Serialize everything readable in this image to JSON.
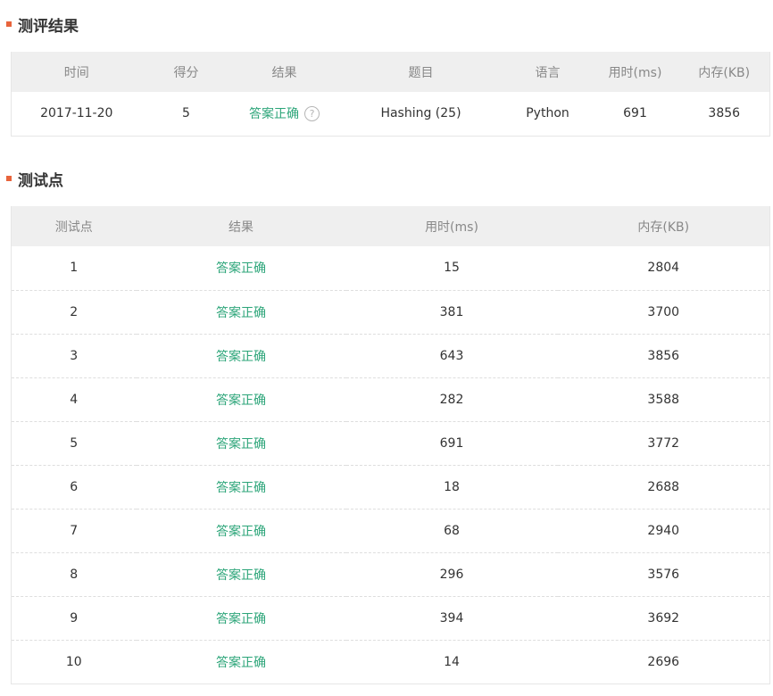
{
  "result_section": {
    "title": "测评结果",
    "headers": [
      "时间",
      "得分",
      "结果",
      "题目",
      "语言",
      "用时(ms)",
      "内存(KB)"
    ],
    "row": {
      "time": "2017-11-20",
      "score": "5",
      "result": "答案正确",
      "problem": "Hashing (25)",
      "language": "Python",
      "time_ms": "691",
      "memory_kb": "3856"
    },
    "help_icon": "help-circle-icon",
    "help_glyph": "?"
  },
  "cases_section": {
    "title": "测试点",
    "headers": [
      "测试点",
      "结果",
      "用时(ms)",
      "内存(KB)"
    ],
    "rows": [
      {
        "id": "1",
        "result": "答案正确",
        "time_ms": "15",
        "memory_kb": "2804"
      },
      {
        "id": "2",
        "result": "答案正确",
        "time_ms": "381",
        "memory_kb": "3700"
      },
      {
        "id": "3",
        "result": "答案正确",
        "time_ms": "643",
        "memory_kb": "3856"
      },
      {
        "id": "4",
        "result": "答案正确",
        "time_ms": "282",
        "memory_kb": "3588"
      },
      {
        "id": "5",
        "result": "答案正确",
        "time_ms": "691",
        "memory_kb": "3772"
      },
      {
        "id": "6",
        "result": "答案正确",
        "time_ms": "18",
        "memory_kb": "2688"
      },
      {
        "id": "7",
        "result": "答案正确",
        "time_ms": "68",
        "memory_kb": "2940"
      },
      {
        "id": "8",
        "result": "答案正确",
        "time_ms": "296",
        "memory_kb": "3576"
      },
      {
        "id": "9",
        "result": "答案正确",
        "time_ms": "394",
        "memory_kb": "3692"
      },
      {
        "id": "10",
        "result": "答案正确",
        "time_ms": "14",
        "memory_kb": "2696"
      }
    ]
  },
  "colors": {
    "accent_marker": "#e8643c",
    "success_text": "#2ca579",
    "header_bg": "#efefef",
    "header_text": "#888888"
  }
}
